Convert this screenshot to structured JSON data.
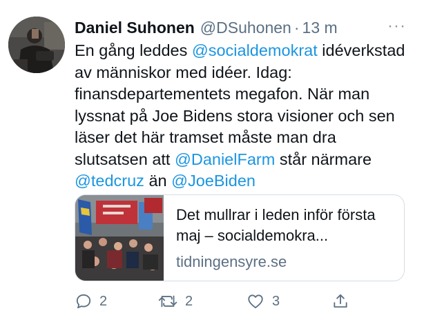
{
  "tweet": {
    "author_name": "Daniel Suhonen",
    "author_handle": "@DSuhonen",
    "separator": "·",
    "time": "13 m",
    "more_label": "···",
    "text": {
      "p1": "En gång leddes ",
      "m1": "@socialdemokrat",
      "p2": " idéverkstad av människor med idéer. Idag: finansdepartementets megafon. När man lyssnat på Joe Bidens stora visioner och sen läser det här tramset måste man dra slutsatsen att ",
      "m2": "@DanielFarm",
      "p3": " står närmare ",
      "m3": "@tedcruz",
      "p4": " än ",
      "m4": "@JoeBiden"
    },
    "link_card": {
      "title": "Det mullrar i leden inför första maj – socialdemokra...",
      "domain": "tidningensyre.se"
    },
    "actions": {
      "reply_count": "2",
      "retweet_count": "2",
      "like_count": "3"
    }
  },
  "icons": {
    "reply": "reply-icon",
    "retweet": "retweet-icon",
    "like": "heart-icon",
    "share": "share-icon"
  },
  "colors": {
    "mention": "#1b95e0",
    "secondary_text": "#5b7083",
    "primary_text": "#0f1419"
  }
}
